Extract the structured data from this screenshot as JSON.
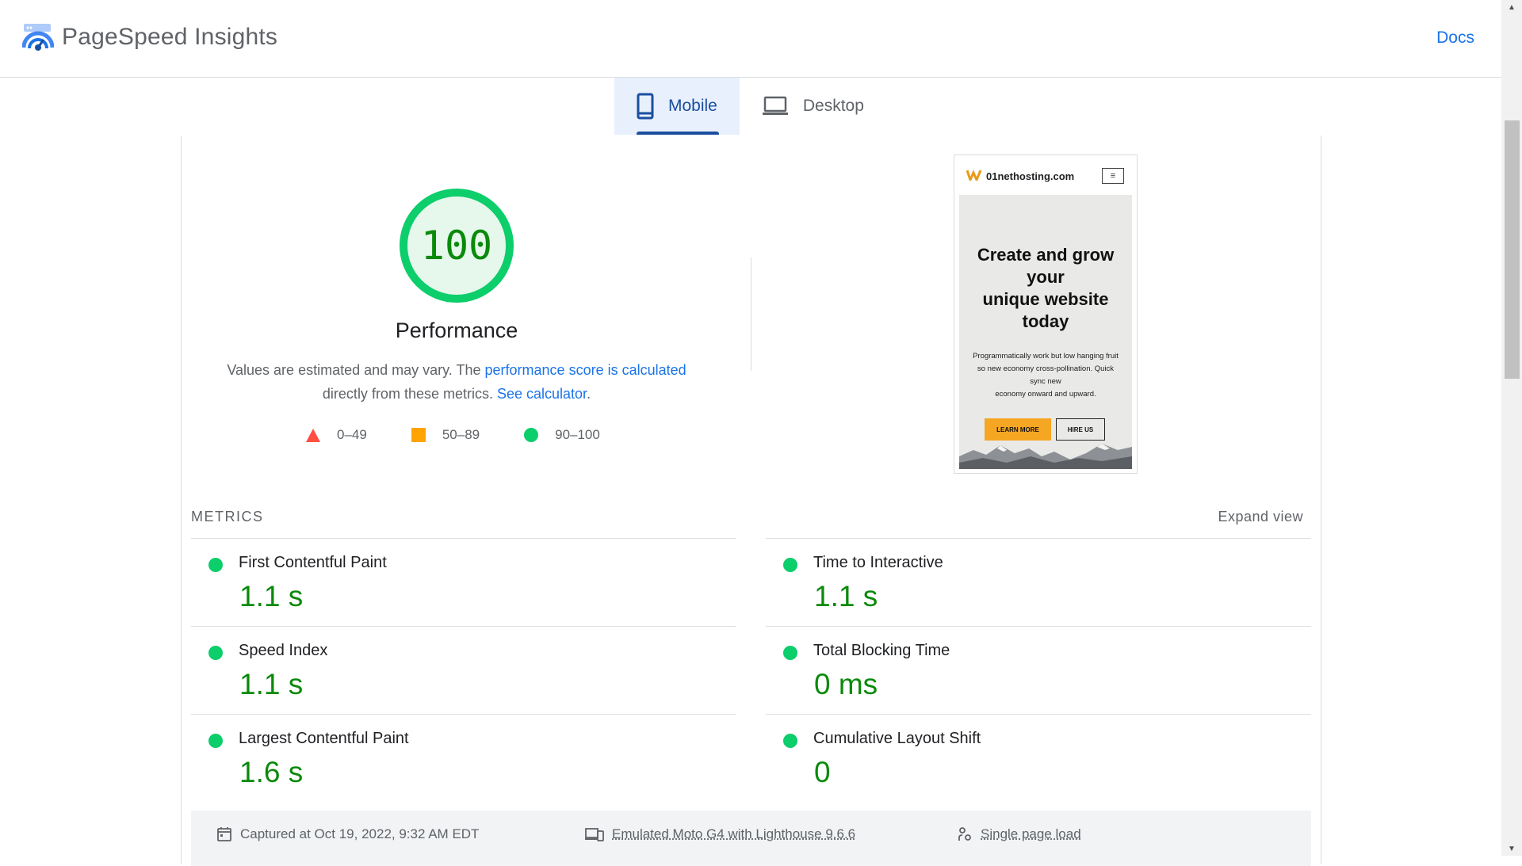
{
  "header": {
    "title": "PageSpeed Insights",
    "docs_label": "Docs"
  },
  "tabs": [
    {
      "label": "Mobile",
      "active": true
    },
    {
      "label": "Desktop",
      "active": false
    }
  ],
  "score": {
    "value": "100",
    "category": "Performance",
    "desc_prefix": "Values are estimated and may vary. The ",
    "desc_link1": "performance score is calculated",
    "desc_middle": " directly from these metrics. ",
    "desc_link2": "See calculator",
    "desc_suffix": "."
  },
  "legend": [
    {
      "range": "0–49",
      "shape": "triangle",
      "color": "#ff4e42"
    },
    {
      "range": "50–89",
      "shape": "square",
      "color": "#ffa400"
    },
    {
      "range": "90–100",
      "shape": "circle",
      "color": "#0cce6b"
    }
  ],
  "preview": {
    "site": "01nethosting.com",
    "menu_glyph": "≡",
    "headline_line1": "Create and grow",
    "headline_line2": "your",
    "headline_line3": "unique website",
    "headline_line4": "today",
    "body_line1": "Programmatically work but low hanging fruit",
    "body_line2": "so new economy cross-pollination. Quick",
    "body_line3": "sync new",
    "body_line4": "economy onward and upward.",
    "button_primary": "LEARN MORE",
    "button_secondary": "HIRE US",
    "accent_color": "#f5a623"
  },
  "metrics": {
    "header": "METRICS",
    "expand_label": "Expand view",
    "items": [
      {
        "label": "First Contentful Paint",
        "value": "1.1 s"
      },
      {
        "label": "Time to Interactive",
        "value": "1.1 s"
      },
      {
        "label": "Speed Index",
        "value": "1.1 s"
      },
      {
        "label": "Total Blocking Time",
        "value": "0 ms"
      },
      {
        "label": "Largest Contentful Paint",
        "value": "1.6 s"
      },
      {
        "label": "Cumulative Layout Shift",
        "value": "0"
      }
    ]
  },
  "info": {
    "captured": "Captured at Oct 19, 2022, 9:32 AM EDT",
    "device": "Emulated Moto G4 with Lighthouse 9.6.6",
    "load": "Single page load"
  },
  "colors": {
    "pass": "#0cce6b",
    "pass_text": "#0a8a0a",
    "link": "#1a73e8",
    "tab_active": "#1a4e9e"
  }
}
